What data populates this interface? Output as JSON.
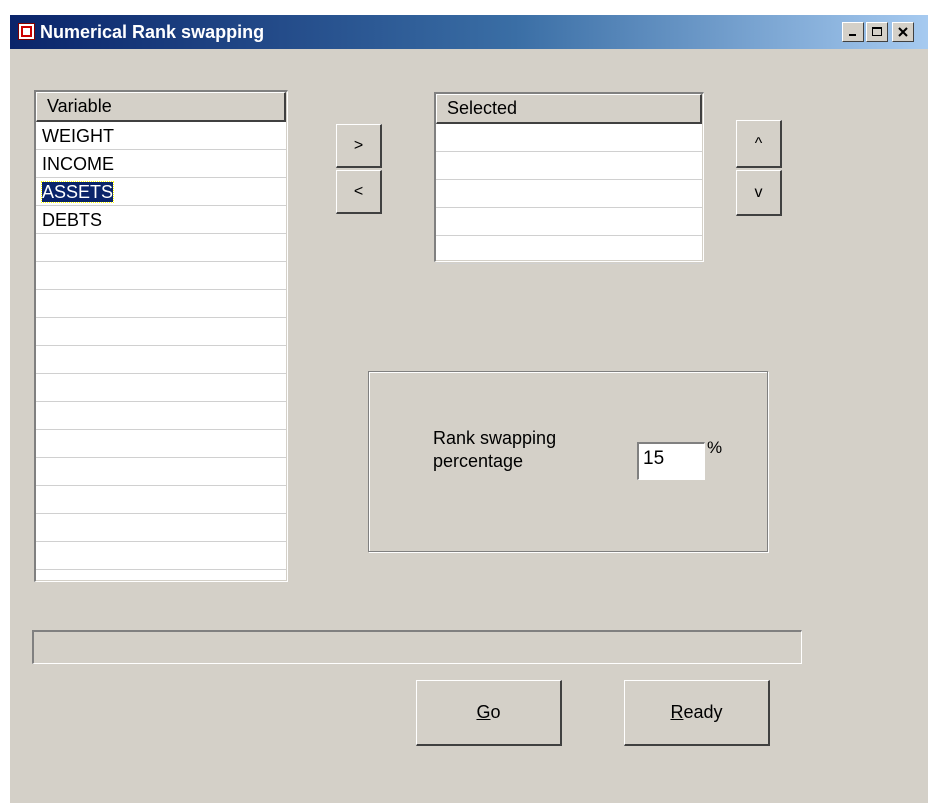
{
  "window": {
    "title": "Numerical Rank swapping",
    "controls": [
      "minimize-icon",
      "maximize-icon",
      "close-icon"
    ]
  },
  "variable_list": {
    "header": "Variable",
    "items": [
      "WEIGHT",
      "INCOME",
      "ASSETS",
      "DEBTS"
    ],
    "selected_item": "ASSETS"
  },
  "selected_list": {
    "header": "Selected",
    "items": []
  },
  "transfer_buttons": {
    "add_label": ">",
    "remove_label": "<"
  },
  "order_buttons": {
    "up_label": "^",
    "down_label": "v"
  },
  "rank_group": {
    "label_line1": "Rank swapping",
    "label_line2": "percentage",
    "value": "15",
    "unit": "%"
  },
  "progress": {
    "fraction": 0
  },
  "actions": {
    "go_label": "Go",
    "go_accel": "G",
    "go_rest": "o",
    "ready_label": "Ready",
    "ready_accel": "R",
    "ready_rest": "eady"
  }
}
